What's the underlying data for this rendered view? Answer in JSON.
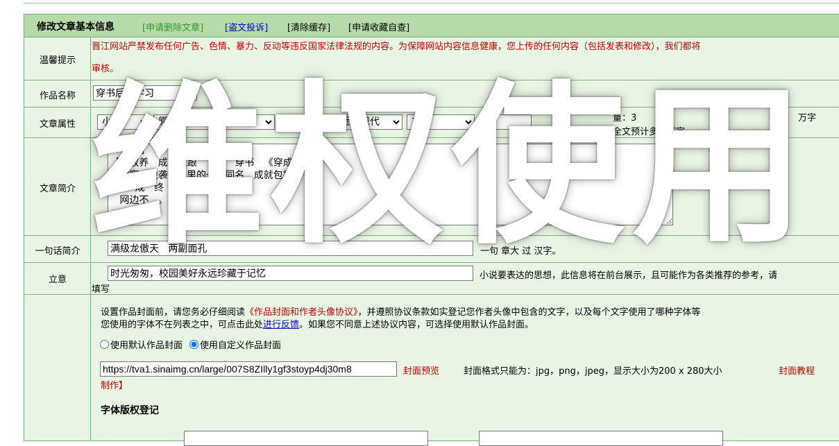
{
  "header": {
    "title": "修改文章基本信息",
    "links": [
      "[申请删除文章]",
      "[盗文投诉]",
      "[清除缓存]",
      "[申请收藏自查]"
    ]
  },
  "rows": {
    "tip_label": "温馨提示",
    "tip_text": "晋江网站严禁发布任何广告、色情、暴力、反动等违反国家法律法规的内容。为保障网站内容信息健康，您上传的任何内容（包括发表和修改），我们都将",
    "tip_text2": "审核。",
    "title_label": "作品名称",
    "title_value": "穿书后靠学习",
    "attr_label": "文章属性",
    "attr_selects": [
      "小",
      "原",
      "",
      "主",
      "近代现代",
      "言情",
      "",
      "公"
    ],
    "attr_word_label": "量：3",
    "attr_word_unit": "万字",
    "attr_word_hint": "全文预计多少万字",
    "summary_label": "文章简介",
    "summary_text": "     自宫\n【   收养   成咸鱼跟   了上   穿书   《穿成   炮灰   》】\n   寒窑   逆袭   说里的一   同名   成就包括   下：\n        成   终   新   哥   继承\n   网边不   。",
    "oneline_label": "一句话简介",
    "oneline_value": "满级龙傲天   两副面孔",
    "oneline_hint": "一句   章大   过   汉字。",
    "intent_label": "立意",
    "intent_value": "时光匆匆，校园美好永远珍藏于记忆",
    "intent_hint": "小说要表达的思想，此信息将在前台展示，且可能作为各类推荐的参考，请",
    "intent_hint2": "填写",
    "cover_notice1a": "设置作品封面前，请您务必仔细阅读",
    "cover_notice1_link": "《作品封面和作者头像协议》",
    "cover_notice1b": "，并遵照协议条款如实登记您作者头像中包含的文字，以及每个文字使用了哪种字体等",
    "cover_notice2a": "您使用的字体不在列表之中，可点击此处",
    "cover_notice2_link": "进行反馈",
    "cover_notice2b": "。如果您不同意上述协议内容，可选择使用默认作品封面。",
    "radio_default": "使用默认作品封面",
    "radio_custom": "使用自定义作品封面",
    "cover_url": "https://tva1.sinaimg.cn/large/007S8ZIlly1gf3stoyp4dj30m8",
    "cover_preview": "封面预览",
    "cover_format": "封面格式只能为：jpg，png，jpeg，显示大小为200 x 280大小",
    "cover_tutorial": "封面教程",
    "cover_make_bracket": "【",
    "cover_make": "制作】",
    "font_title": "字体版权登记"
  },
  "watermark": "维权使用"
}
